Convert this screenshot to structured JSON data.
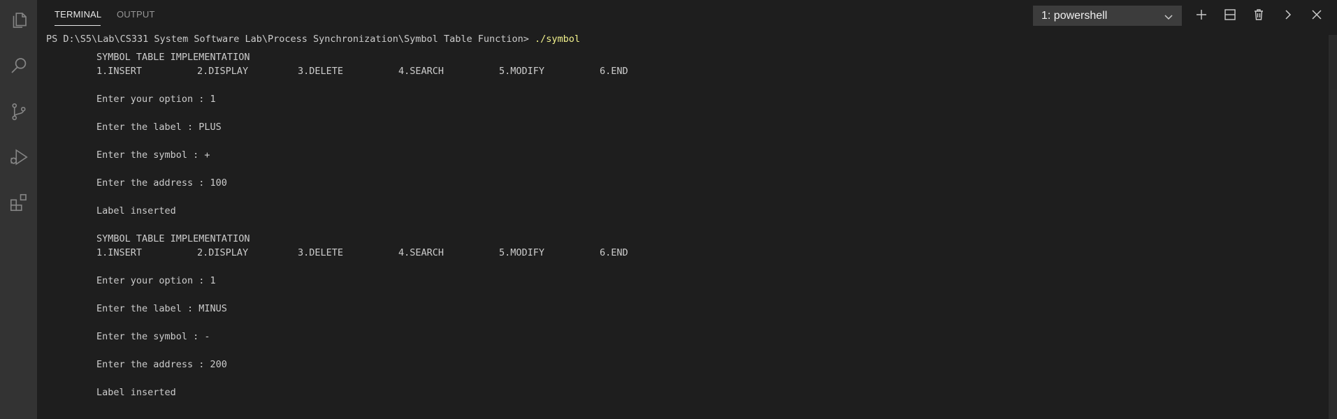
{
  "activity_bar": {
    "icons": [
      "files-icon",
      "search-icon",
      "source-control-icon",
      "run-debug-icon",
      "extensions-icon"
    ]
  },
  "panel": {
    "tabs": [
      {
        "label": "TERMINAL",
        "active": true
      },
      {
        "label": "OUTPUT",
        "active": false
      }
    ],
    "terminal_select": {
      "value": "1: powershell"
    },
    "toolbar_icons": [
      "plus-icon",
      "split-icon",
      "trash-icon",
      "chevron-right-icon",
      "close-icon"
    ]
  },
  "terminal": {
    "prompt": "PS D:\\S5\\Lab\\CS331 System Software Lab\\Process Synchronization\\Symbol Table Function> ",
    "command": "./symbol",
    "blocks": [
      {
        "title": "SYMBOL TABLE IMPLEMENTATION",
        "menu": [
          "1.INSERT",
          "2.DISPLAY",
          "3.DELETE",
          "4.SEARCH",
          "5.MODIFY",
          "6.END"
        ],
        "option": "Enter your option : 1",
        "label": "Enter the label : PLUS",
        "symbol": "Enter the symbol : +",
        "address": "Enter the address : 100",
        "result": "Label inserted"
      },
      {
        "title": "SYMBOL TABLE IMPLEMENTATION",
        "menu": [
          "1.INSERT",
          "2.DISPLAY",
          "3.DELETE",
          "4.SEARCH",
          "5.MODIFY",
          "6.END"
        ],
        "option": "Enter your option : 1",
        "label": "Enter the label : MINUS",
        "symbol": "Enter the symbol : -",
        "address": "Enter the address : 200",
        "result": "Label inserted"
      }
    ]
  },
  "colors": {
    "background": "#1e1e1e",
    "activity_bar": "#333333",
    "text": "#cccccc",
    "command": "#f1f18c",
    "icon": "#858585"
  }
}
